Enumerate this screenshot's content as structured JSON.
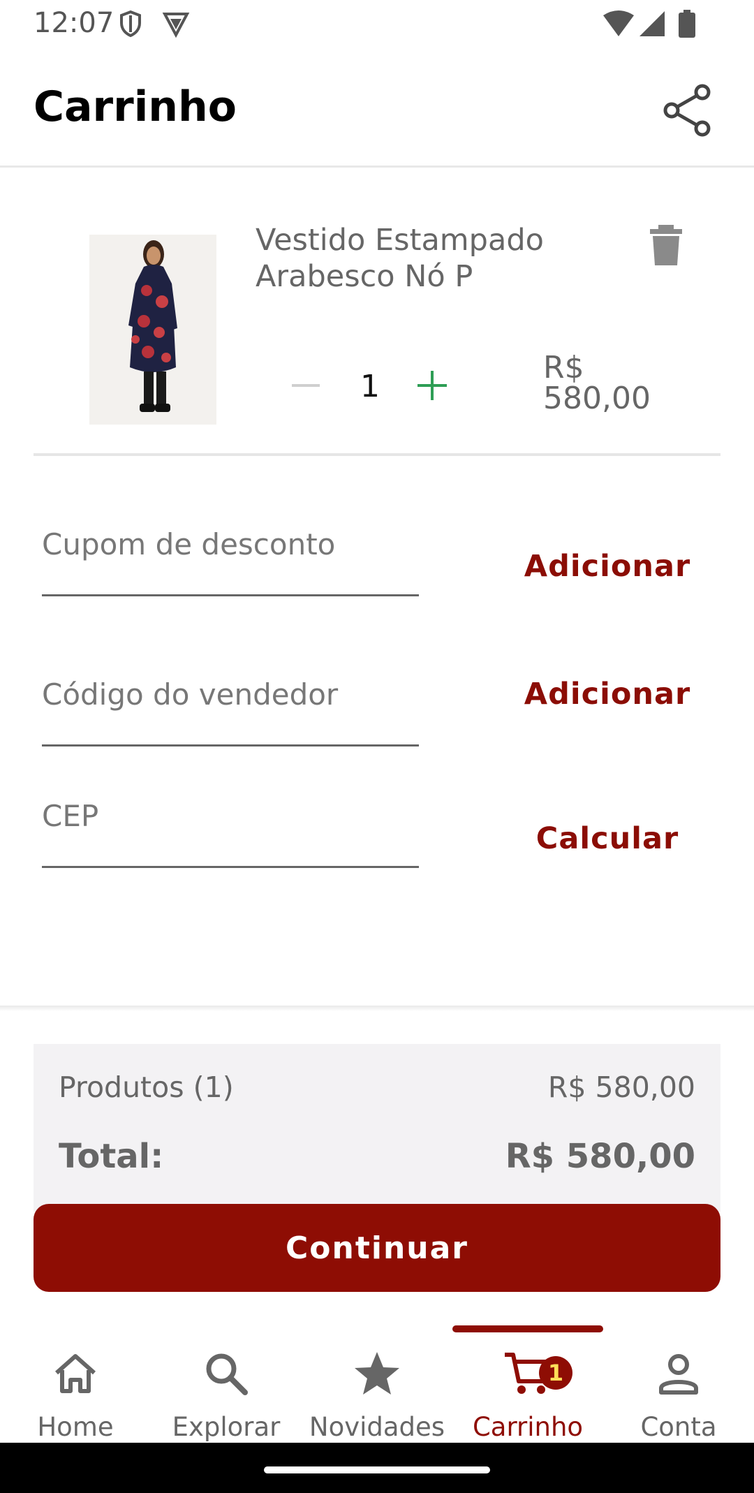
{
  "status_bar": {
    "time": "12:07"
  },
  "header": {
    "title": "Carrinho"
  },
  "cart_item": {
    "name": "Vestido Estampado Arabesco Nó P",
    "quantity": "1",
    "price_currency": "R$",
    "price_value": "580,00"
  },
  "coupon": {
    "placeholder": "Cupom de desconto",
    "action": "Adicionar"
  },
  "seller": {
    "placeholder": "Código do vendedor",
    "action": "Adicionar"
  },
  "cep": {
    "placeholder": "CEP",
    "action": "Calcular"
  },
  "summary": {
    "products_label": "Produtos (1)",
    "products_value": "R$ 580,00",
    "total_label": "Total:",
    "total_value": "R$ 580,00",
    "continue_label": "Continuar"
  },
  "bottom_nav": {
    "items": [
      {
        "label": "Home",
        "icon": "home-icon"
      },
      {
        "label": "Explorar",
        "icon": "search-icon"
      },
      {
        "label": "Novidades",
        "icon": "star-icon"
      },
      {
        "label": "Carrinho",
        "icon": "cart-icon",
        "badge": "1",
        "active": true
      },
      {
        "label": "Conta",
        "icon": "person-icon"
      }
    ]
  },
  "colors": {
    "accent": "#8e0d04",
    "badge_text": "#ffde59",
    "plus_green": "#2e9e55"
  }
}
